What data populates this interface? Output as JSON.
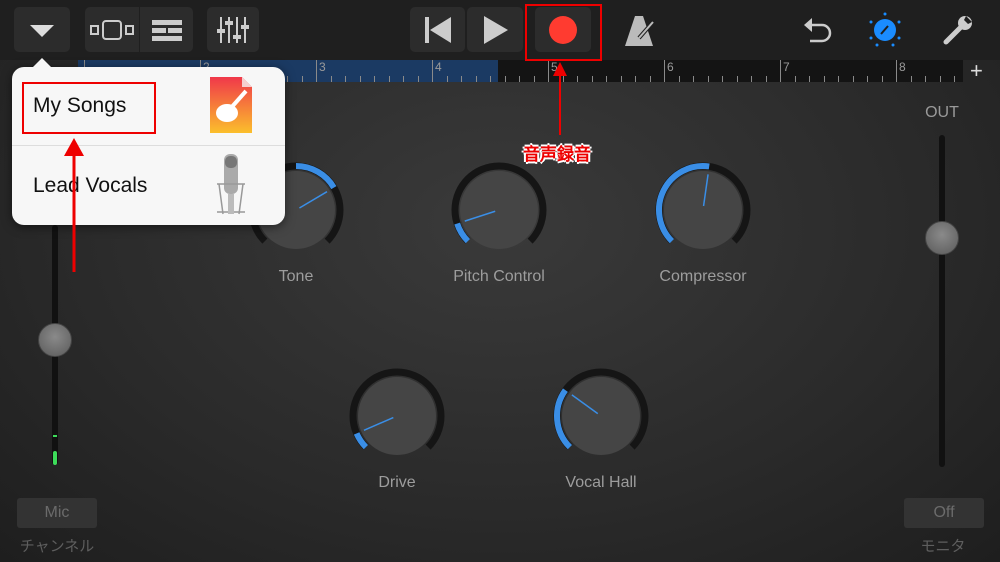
{
  "toolbar": {
    "buttons": [
      {
        "name": "browser-menu-button",
        "icon": "triangle-down-icon"
      },
      {
        "name": "tracks-view-button",
        "icon": "track-view-icon"
      },
      {
        "name": "instrument-view-button",
        "icon": "rows-icon"
      },
      {
        "name": "mixer-button",
        "icon": "sliders-icon"
      },
      {
        "name": "go-to-start-button",
        "icon": "skip-back-icon"
      },
      {
        "name": "play-button",
        "icon": "play-icon"
      },
      {
        "name": "record-button",
        "icon": "record-icon"
      },
      {
        "name": "metronome-button",
        "icon": "metronome-icon"
      },
      {
        "name": "undo-button",
        "icon": "undo-icon"
      },
      {
        "name": "master-effects-button",
        "icon": "knob-icon"
      },
      {
        "name": "settings-button",
        "icon": "wrench-icon"
      }
    ]
  },
  "ruler": {
    "bars": [
      "2",
      "3",
      "4",
      "5",
      "6",
      "7",
      "8"
    ],
    "add_label": "+"
  },
  "colors": {
    "accent": "#3a8ee6",
    "record": "#ff3b30",
    "annotation": "#e00000",
    "meter": "#3ddc5a"
  },
  "popover": {
    "items": [
      {
        "label": "My Songs",
        "icon": "garageband-document-icon"
      },
      {
        "label": "Lead Vocals",
        "icon": "microphone-icon"
      }
    ]
  },
  "knobs": [
    {
      "label": "Tone",
      "value": 0.72,
      "bipolar": true
    },
    {
      "label": "Pitch Control",
      "value": 0.1,
      "bipolar": false
    },
    {
      "label": "Compressor",
      "value": 0.53,
      "bipolar": false
    },
    {
      "label": "Drive",
      "value": 0.08,
      "bipolar": false
    },
    {
      "label": "Vocal Hall",
      "value": 0.3,
      "bipolar": false
    }
  ],
  "input": {
    "button": "Mic",
    "caption": "チャンネル",
    "level": 0.35
  },
  "output": {
    "label": "OUT",
    "button": "Off",
    "caption": "モニタ",
    "level": 0.69
  },
  "annotations": {
    "record": "音声録音"
  }
}
